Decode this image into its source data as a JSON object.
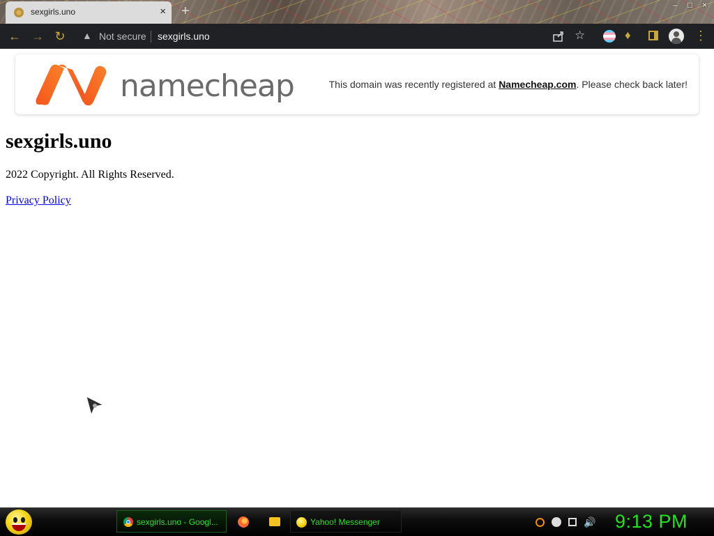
{
  "browser": {
    "tab_title": "sexgirls.uno",
    "tab_close": "×",
    "new_tab": "+",
    "window_controls": [
      "–",
      "□",
      "×"
    ],
    "security_label": "Not secure",
    "url": "sexgirls.uno",
    "accent_color": "#c6a93a"
  },
  "page": {
    "banner": {
      "brand": "namecheap",
      "message_prefix": "This domain was recently registered at ",
      "message_link": "Namecheap.com",
      "message_suffix": ". Please check back later!",
      "brand_color": "#f25c1d"
    },
    "heading": "sexgirls.uno",
    "copyright": "2022 Copyright. All Rights Reserved.",
    "privacy_link": "Privacy Policy"
  },
  "taskbar": {
    "tasks": [
      {
        "label": "sexgirls.uno - Googl...",
        "icon": "chrome-icon"
      },
      {
        "label": "",
        "icon": "firefox-icon"
      },
      {
        "label": "",
        "icon": "file-explorer-icon"
      },
      {
        "label": "Yahoo! Messenger",
        "icon": "yahoo-messenger-icon"
      }
    ],
    "tray_icons": [
      "search-icon",
      "status-icon",
      "network-icon",
      "volume-icon"
    ],
    "clock": "9:13 PM",
    "clock_color": "#25e01f"
  }
}
